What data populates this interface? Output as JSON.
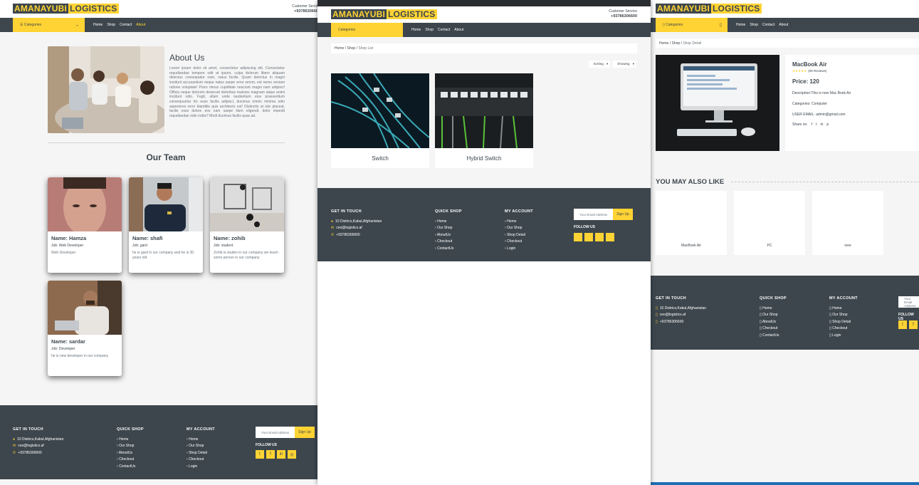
{
  "brand": {
    "part1": "AMANAYUBI",
    "part2": "LOGISTICS"
  },
  "customer_service": {
    "label": "Customer Service",
    "phone": "+93786306600"
  },
  "categories_label": "Categories",
  "nav": [
    "Home",
    "Shop",
    "Contact",
    "About"
  ],
  "about": {
    "title": "About Us",
    "body": "Lorem ipsum dolor sit amet, consectetur adipiscing elit. Consectetur repudiandae tempore odit at ipsum, culpa dolorum libero aliquam delectus consequatur nam, natus facilis. Quam delectus in magni incidunt accusantium neque natus saepe error servm, est nemo veniam ratione voluptate! Porro minus cupiditate nesciunt magni nam adipisci! Officia neque dolorem deserunt doloribus maiores magnam atque animi incidunt odio. Fugit, ullam unde laudantium eius praesentium consequuntur hic esse facilis adipisci, ducimus omnis minima odio asperiores error blanditis quis architecto est! Distinctio at iste placeat, facilis esse dolore eos nam saepe illum eligendi, dolor impedit repudiandae odio nobis? Modi ducimus facilis quas ad."
  },
  "team": {
    "title": "Our Team",
    "members": [
      {
        "name": "Name: Hamza",
        "job": "Job: Web Developer",
        "desc": "Web Developer"
      },
      {
        "name": "Name: shafi",
        "job": "Job: gard",
        "desc": "he is gard in our company and he is 30 years old"
      },
      {
        "name": "Name: zohib",
        "job": "Job: student",
        "desc": "Zohib is studen in our company we teach some person in our company"
      },
      {
        "name": "Name: sardar",
        "job": "Job: Developer",
        "desc": "he is new developer in our company"
      }
    ]
  },
  "footer": {
    "get_in_touch": {
      "title": "GET IN TOUCH",
      "address": "10 Districs,Kabul,Afghanistan",
      "email": "ceo@logistics.af",
      "phone": "+93786306600"
    },
    "quick_shop": {
      "title": "QUICK SHOP",
      "links": [
        "Home",
        "Our Shop",
        "AboutUs",
        "Checkout",
        "ContactUs"
      ]
    },
    "my_account": {
      "title": "MY ACCOUNT",
      "links": [
        "Home",
        "Our Shop",
        "Shop Detail",
        "Checkout",
        "Login"
      ]
    },
    "newsletter": {
      "placeholder": "Your Email Address",
      "button": "Sign Up"
    },
    "follow": "FOLLOW US",
    "social_icons": [
      "twitter-icon",
      "facebook-icon",
      "linkedin-icon",
      "instagram-icon"
    ]
  },
  "shop_list": {
    "breadcrumb": [
      "Home",
      "Shop",
      "Shop List"
    ],
    "sorting": "Sorting",
    "showing": "Showing",
    "products": [
      {
        "name": "Switch"
      },
      {
        "name": "Hybrid Switch"
      }
    ]
  },
  "shop_detail": {
    "breadcrumb": [
      "Home",
      "Shop",
      "Shop Detail"
    ],
    "product_name": "MacBook Air",
    "reviews": "(99 Reviews)",
    "price": "Price: 120",
    "description": "Description:This is new Mac Book Air",
    "category": "Categories: Computer",
    "user_email": "USER EMAIL: admin@gmail.com",
    "share_label": "Share on:",
    "you_may_also_like": "YOU MAY ALSO LIKE",
    "related": [
      "MacBook Air",
      "PC",
      "new"
    ]
  },
  "colors": {
    "primary": "#ffd333",
    "dark": "#3d464d",
    "light": "#f5f5f5"
  }
}
